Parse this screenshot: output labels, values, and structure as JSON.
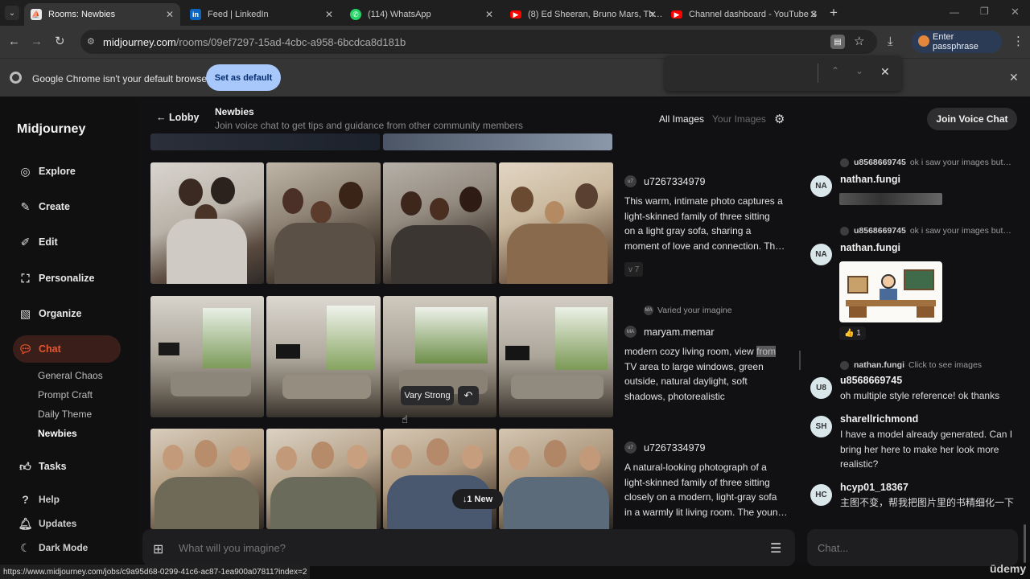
{
  "browser": {
    "tabs": [
      {
        "label": "Rooms: Newbies",
        "active": true
      },
      {
        "label": "Feed | LinkedIn"
      },
      {
        "label": "(114) WhatsApp"
      },
      {
        "label": "(8) Ed Sheeran, Bruno Mars, Th…"
      },
      {
        "label": "Channel dashboard - YouTube S"
      }
    ],
    "url_host": "midjourney.com",
    "url_path": "/rooms/09ef7297-15ad-4cbc-a958-6bcdca8d181b",
    "passphrase_label": "Enter passphrase",
    "infobar_message": "Google Chrome isn't your default browser",
    "set_default_label": "Set as default",
    "status_url": "https://www.midjourney.com/jobs/c9a95d68-0299-41c6-ac87-1ea900a07811?index=2"
  },
  "app": {
    "brand": "Midjourney",
    "nav": {
      "explore": "Explore",
      "create": "Create",
      "edit": "Edit",
      "personalize": "Personalize",
      "organize": "Organize",
      "chat": "Chat",
      "tasks": "Tasks",
      "help": "Help",
      "updates": "Updates",
      "dark_mode": "Dark Mode"
    },
    "rooms": [
      "General Chaos",
      "Prompt Craft",
      "Daily Theme",
      "Newbies"
    ],
    "accent": "#e8572e"
  },
  "header": {
    "back_label": "Lobby",
    "room_title": "Newbies",
    "room_desc": "Join voice chat to get tips and guidance from other community members",
    "all_images": "All Images",
    "your_images": "Your Images",
    "voice_chat": "Join Voice Chat"
  },
  "feed": [
    {
      "user": "u7267334979",
      "avatar": "u7",
      "prompt": [
        "This warm, intimate photo captures a",
        "light-skinned family of three sitting",
        "on a light gray sofa, sharing a",
        "moment of love and connection. Th…"
      ],
      "badge": "v 7"
    },
    {
      "reply_label": "Varied your imagine",
      "reply_avatar": "MA",
      "user": "maryam.memar",
      "avatar": "MA",
      "prompt_first": "modern cozy living room, view ",
      "prompt_highlight": "from",
      "prompt": [
        "TV area to large windows, green",
        "outside, natural daylight, soft",
        "shadows, photorealistic"
      ],
      "vary_label": "Vary Strong"
    },
    {
      "user": "u7267334979",
      "avatar": "u7",
      "prompt": [
        "A natural-looking photograph of a",
        "light-skinned family of three sitting",
        "closely on a modern, light-gray sofa",
        "in a warmly lit living room. The youn…"
      ],
      "new_label": "1 New"
    }
  ],
  "chat": [
    {
      "reply_user": "u8568669745",
      "reply_text": "ok i saw your images but…",
      "avatar": "NA",
      "user": "nathan.fungi"
    },
    {
      "reply_user": "u8568669745",
      "reply_text": "ok i saw your images but…",
      "avatar": "NA",
      "user": "nathan.fungi",
      "reaction": "👍 1"
    },
    {
      "reply_user": "nathan.fungi",
      "reply_text": "Click to see images",
      "avatar": "U8",
      "user": "u8568669745",
      "text": [
        "oh multiple style reference! ok thanks"
      ]
    },
    {
      "avatar": "SH",
      "user": "sharellrichmond",
      "text": [
        "I have a model already generated. Can I",
        "bring her here to make her look more",
        "realistic?"
      ]
    },
    {
      "avatar": "HC",
      "user": "hcyp01_18367",
      "text": [
        "主图不变，帮我把图片里的书精细化一下"
      ]
    }
  ],
  "composer": {
    "placeholder": "What will you imagine?",
    "chat_placeholder": "Chat..."
  },
  "watermark": "ūdemy"
}
